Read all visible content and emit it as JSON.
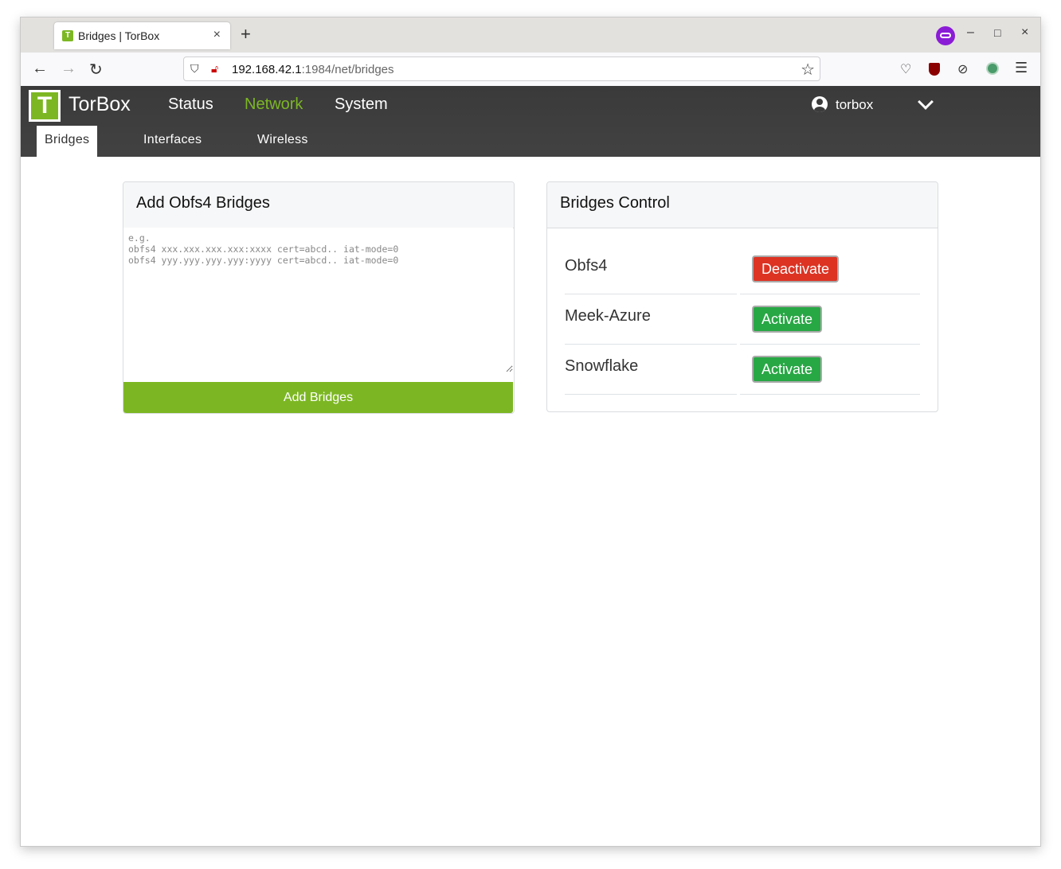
{
  "browser": {
    "tab_title": "Bridges | TorBox",
    "tab_favicon_letter": "T",
    "tab_close": "×",
    "new_tab": "+",
    "url_host": "192.168.42.1",
    "url_rest": ":1984/net/bridges",
    "window_controls": {
      "minimize": "–",
      "maximize": "□",
      "close": "×"
    }
  },
  "app": {
    "logo_letter": "T",
    "brand": "TorBox",
    "main_nav": [
      "Status",
      "Network",
      "System"
    ],
    "active_main_nav": "Network",
    "username": "torbox",
    "sub_nav": [
      "Bridges",
      "Interfaces",
      "Wireless"
    ],
    "active_sub_nav": "Bridges",
    "accent_color": "#7cb723"
  },
  "add_bridges_card": {
    "title": "Add Obfs4 Bridges",
    "placeholder": "e.g.\nobfs4 xxx.xxx.xxx.xxx:xxxx cert=abcd.. iat-mode=0\nobfs4 yyy.yyy.yyy.yyy:yyyy cert=abcd.. iat-mode=0",
    "button_label": "Add Bridges"
  },
  "bridges_control_card": {
    "title": "Bridges Control",
    "rows": [
      {
        "name": "Obfs4",
        "action": "Deactivate",
        "action_color": "#dc3323"
      },
      {
        "name": "Meek-Azure",
        "action": "Activate",
        "action_color": "#28a745"
      },
      {
        "name": "Snowflake",
        "action": "Activate",
        "action_color": "#28a745"
      }
    ]
  }
}
